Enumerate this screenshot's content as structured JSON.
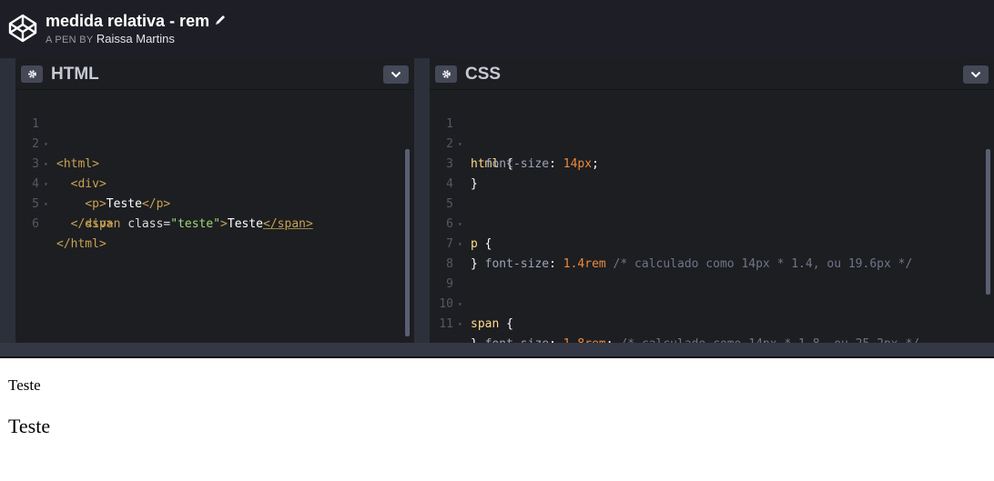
{
  "header": {
    "title": "medida relativa - rem",
    "byline_prefix": "A PEN BY",
    "author": "Raissa Martins",
    "logo_icon": "codepen-cube-icon",
    "edit_icon": "pencil-icon",
    "background": "#1e1f26"
  },
  "html_panel": {
    "title": "HTML",
    "settings_icon": "gear-icon",
    "collapse_icon": "chevron-down-icon",
    "line_numbers": [
      "1",
      "2",
      "3",
      "4",
      "5",
      "6"
    ]
  },
  "css_panel": {
    "title": "CSS",
    "settings_icon": "gear-icon",
    "collapse_icon": "chevron-down-icon",
    "line_numbers": [
      "1",
      "2",
      "3",
      "4",
      "5",
      "6",
      "7",
      "8",
      "9",
      "10",
      "11"
    ]
  },
  "code": {
    "html": {
      "l1_tag": "<html>",
      "l2_tag": "<div>",
      "l3_open": "<p>",
      "l3_text": "Teste",
      "l3_close": "</p>",
      "l4_open": "<span ",
      "l4_attr": "class",
      "l4_eq": "=",
      "l4_val": "\"teste\"",
      "l4_gt": ">",
      "l4_text": "Teste",
      "l4_close": "</span>",
      "l5_tag": "</div>",
      "l6_tag": "</html>"
    },
    "css": {
      "l1_sel": "html",
      "l1_brace": " {",
      "l2_prop": "font-size",
      "l2_colon": ": ",
      "l2_val": "14px",
      "l2_semi": ";",
      "l3_brace": "}",
      "l5_sel": "p",
      "l5_brace": " {",
      "l6_prop": "font-size",
      "l6_colon": ": ",
      "l6_val": "1.4rem",
      "l6_comment": " /* calculado como 14px * 1.4, ou 19.6px */",
      "l7_brace": "}",
      "l9_sel": "span",
      "l9_brace": " {",
      "l10_prop": "font-size",
      "l10_colon": ": ",
      "l10_val": "1.8rem",
      "l10_semi": ";",
      "l10_comment": " /* calculado como 14px * 1.8, ou 25.2px */",
      "l11_brace": "}"
    }
  },
  "preview": {
    "paragraph_text": "Teste",
    "span_text": "Teste"
  }
}
